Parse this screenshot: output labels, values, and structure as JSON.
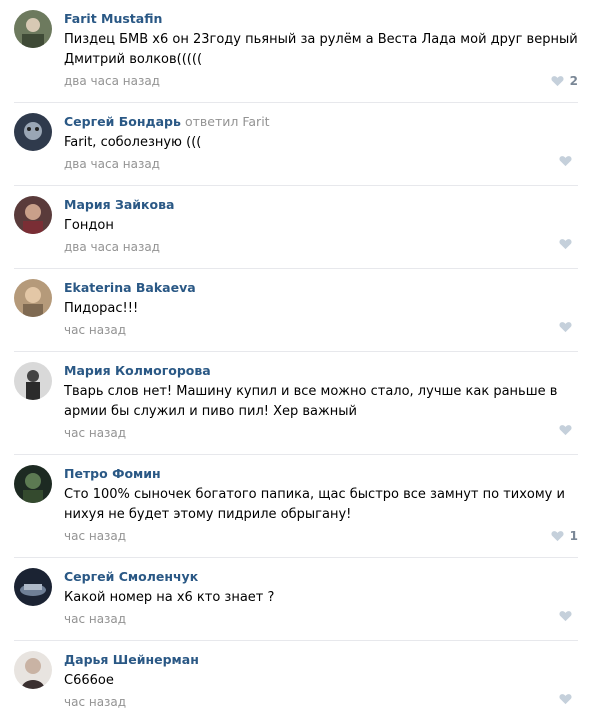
{
  "comments": [
    {
      "author": "Farit Mustafin",
      "reply_to": "",
      "text": "Пиздец БМВ х6 он 23году пьяный за рулём а Веста Лада мой друг верный Дмитрий волков(((((",
      "time": "два часа назад",
      "likes": "2"
    },
    {
      "author": "Сергей Бондарь",
      "reply_to": "ответил Farit",
      "text": "Farit, соболезную (((",
      "time": "два часа назад",
      "likes": ""
    },
    {
      "author": "Мария Зайкова",
      "reply_to": "",
      "text": "Гондон",
      "time": "два часа назад",
      "likes": ""
    },
    {
      "author": "Ekaterina Bakaeva",
      "reply_to": "",
      "text": "Пидорас!!!",
      "time": "час назад",
      "likes": ""
    },
    {
      "author": "Мария Колмогорова",
      "reply_to": "",
      "text": "Тварь слов нет! Машину купил и все можно стало, лучше как раньше в армии бы служил и пиво пил! Хер важный",
      "time": "час назад",
      "likes": ""
    },
    {
      "author": "Петро Фомин",
      "reply_to": "",
      "text": "Сто 100% сыночек богатого папика, щас быстро все замнут по тихому и нихуя не будет этому пидриле обрыгану!",
      "time": "час назад",
      "likes": "1"
    },
    {
      "author": "Сергей Смоленчук",
      "reply_to": "",
      "text": "Какой номер на х6 кто знает ?",
      "time": "час назад",
      "likes": ""
    },
    {
      "author": "Дарья Шейнерман",
      "reply_to": "",
      "text": "С666ое",
      "time": "час назад",
      "likes": ""
    }
  ],
  "colors": {
    "author_link": "#2a5885",
    "muted": "#939393",
    "heart": "#c5d0db",
    "divider": "#e7e8ec"
  },
  "icons": {
    "like": "heart-icon"
  }
}
